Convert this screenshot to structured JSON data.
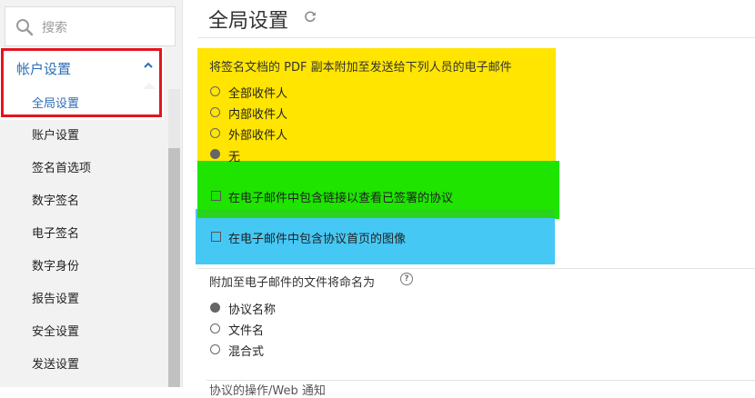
{
  "sidebar": {
    "search_placeholder": "搜索",
    "section_label": "帐户设置",
    "items": [
      {
        "label": "全局设置"
      },
      {
        "label": "账户设置"
      },
      {
        "label": "签名首选项"
      },
      {
        "label": "数字签名"
      },
      {
        "label": "电子签名"
      },
      {
        "label": "数字身份"
      },
      {
        "label": "报告设置"
      },
      {
        "label": "安全设置"
      },
      {
        "label": "发送设置"
      }
    ]
  },
  "main": {
    "title": "全局设置",
    "attach_question": "将签名文档的 PDF 副本附加至发送给下列人员的电子邮件",
    "attach_options": [
      {
        "label": "全部收件人",
        "selected": false
      },
      {
        "label": "内部收件人",
        "selected": false
      },
      {
        "label": "外部收件人",
        "selected": false
      },
      {
        "label": "无",
        "selected": true
      }
    ],
    "check_link": "在电子邮件中包含链接以查看已签署的协议",
    "check_image": "在电子邮件中包含协议首页的图像",
    "naming_question": "附加至电子邮件的文件将命名为",
    "naming_options": [
      {
        "label": "协议名称",
        "selected": true
      },
      {
        "label": "文件名",
        "selected": false
      },
      {
        "label": "混合式",
        "selected": false
      }
    ],
    "partial_text": "协议的操作/Web 通知"
  },
  "colors": {
    "accent": "#2d6eb5",
    "highlight_yellow": "#ffe500",
    "highlight_green": "#1ee400",
    "highlight_blue": "#46c8f5",
    "annotation_red": "#e3141f"
  }
}
